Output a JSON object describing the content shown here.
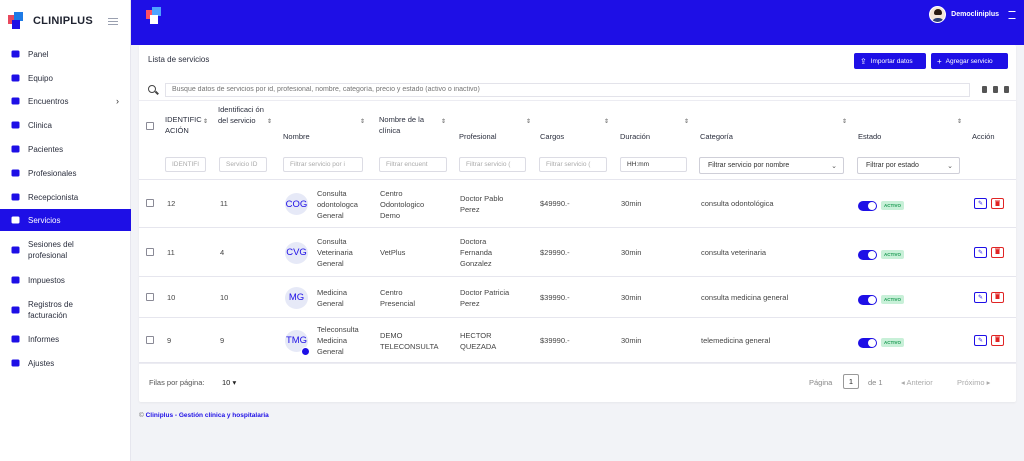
{
  "brand": {
    "name": "CLINIPLUS"
  },
  "sidebar": {
    "items": [
      {
        "label": "Panel",
        "icon": "gauge-icon"
      },
      {
        "label": "Equipo",
        "icon": "monitor-icon"
      },
      {
        "label": "Encuentros",
        "icon": "calendar-icon",
        "chevron": "›"
      },
      {
        "label": "Clinica",
        "icon": "hospital-icon"
      },
      {
        "label": "Pacientes",
        "icon": "patients-icon"
      },
      {
        "label": "Profesionales",
        "icon": "user-icon"
      },
      {
        "label": "Recepcionista",
        "icon": "receptionist-icon"
      },
      {
        "label": "Servicios",
        "icon": "list-icon"
      },
      {
        "label": "Sesiones del profesional",
        "icon": "calendar-icon"
      },
      {
        "label": "Impuestos",
        "icon": "tax-icon"
      },
      {
        "label": "Registros de facturación",
        "icon": "file-icon"
      },
      {
        "label": "Informes",
        "icon": "chart-icon"
      },
      {
        "label": "Ajustes",
        "icon": "gears-icon"
      }
    ],
    "active_index": 7
  },
  "topbar": {
    "username": "Democliniplus"
  },
  "card": {
    "title": "Lista de servicios",
    "import_label": "Importar datos",
    "add_label": "Agregar servicio",
    "search_placeholder": "Busque datos de servicios por id, profesional, nombre, categoría, precio y estado (activo o inactivo)"
  },
  "columns": {
    "id": "IDENTIFIC ACIÓN",
    "service_id": "Identificaci ón del servicio",
    "name": "Nombre",
    "clinic": "Nombre de la clínica",
    "professional": "Profesional",
    "charges": "Cargos",
    "duration": "Duración",
    "category": "Categoría",
    "status": "Estado",
    "action": "Acción"
  },
  "filters": {
    "id": "IDENTIFI",
    "service_id": "Servicio ID",
    "name": "Filtrar servicio por i",
    "clinic": "Filtrar encuent",
    "professional": "Filtrar servicio (",
    "charges": "Filtrar servicio (",
    "duration": "HH:mm",
    "category": "Filtrar servicio por nombre",
    "status": "Filtrar por estado"
  },
  "rows": [
    {
      "id": "12",
      "service_id": "11",
      "avatar": "COG",
      "name": [
        "Consulta",
        "odontologca",
        "General"
      ],
      "clinic": [
        "Centro",
        "Odontologico",
        "Demo"
      ],
      "professional": [
        "Doctor Pablo",
        "Perez"
      ],
      "charges": "$49990.-",
      "duration": "30min",
      "category": "consulta odontológica",
      "status": "ACTIVO"
    },
    {
      "id": "11",
      "service_id": "4",
      "avatar": "CVG",
      "name": [
        "Consulta",
        "Veterinaria",
        "General"
      ],
      "clinic": [
        "VetPlus"
      ],
      "professional": [
        "Doctora",
        "Fernanda",
        "Gonzalez"
      ],
      "charges": "$29990.-",
      "duration": "30min",
      "category": "consulta veterinaria",
      "status": "ACTIVO"
    },
    {
      "id": "10",
      "service_id": "10",
      "avatar": "MG",
      "name": [
        "Medicina",
        "General"
      ],
      "clinic": [
        "Centro",
        "Presencial"
      ],
      "professional": [
        "Doctor Patricia",
        "Perez"
      ],
      "charges": "$39990.-",
      "duration": "30min",
      "category": "consulta medicina general",
      "status": "ACTIVO"
    },
    {
      "id": "9",
      "service_id": "9",
      "avatar": "TMG",
      "name": [
        "Teleconsulta",
        "Medicina",
        "General"
      ],
      "clinic": [
        "DEMO",
        "TELECONSULTA"
      ],
      "professional": [
        "HECTOR",
        "QUEZADA"
      ],
      "charges": "$39990.-",
      "duration": "30min",
      "category": "telemedicina general",
      "status": "ACTIVO"
    }
  ],
  "pagination": {
    "rows_per_page_label": "Filas por página:",
    "rows_per_page": "10",
    "page_label": "Página",
    "page": "1",
    "of_label": "de 1",
    "prev": "Anterior",
    "next": "Próximo"
  },
  "footer": {
    "copyright": "Cliniplus - Gestión clínica y hospitalaria"
  },
  "colors": {
    "primary": "#1e0fe6",
    "danger": "#e02424",
    "success": "#1a9a52"
  }
}
